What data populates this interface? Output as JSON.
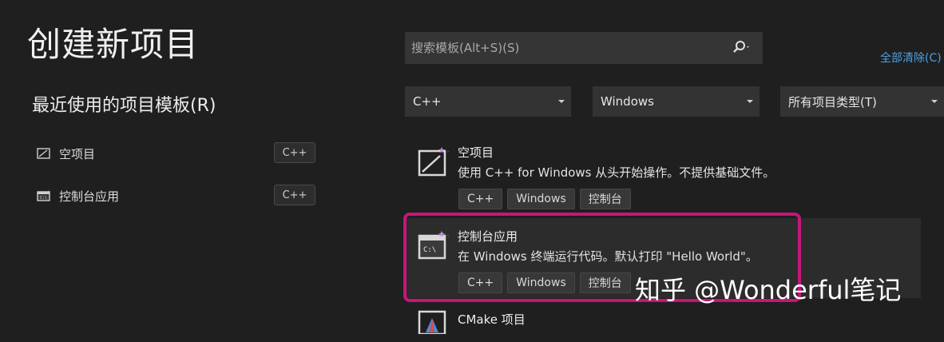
{
  "page": {
    "title": "创建新项目"
  },
  "recent": {
    "title": "最近使用的项目模板(R)",
    "items": [
      {
        "label": "空项目",
        "tag": "C++",
        "icon": "empty-project-icon"
      },
      {
        "label": "控制台应用",
        "tag": "C++",
        "icon": "console-app-icon"
      }
    ]
  },
  "search": {
    "placeholder": "搜索模板(Alt+S)(S)",
    "icon": "search-icon"
  },
  "clear_all": "全部清除(C)",
  "filters": {
    "language": "C++",
    "platform": "Windows",
    "project_type": "所有项目类型(T)"
  },
  "templates": [
    {
      "name": "空项目",
      "description": "使用 C++ for Windows 从头开始操作。不提供基础文件。",
      "tags": [
        "C++",
        "Windows",
        "控制台"
      ]
    },
    {
      "name": "控制台应用",
      "description": "在 Windows 终端运行代码。默认打印 \"Hello World\"。",
      "tags": [
        "C++",
        "Windows",
        "控制台"
      ]
    },
    {
      "name": "CMake 项目"
    }
  ],
  "watermark": "知乎 @Wonderful笔记",
  "colors": {
    "background": "#1f1f1f",
    "link": "#4f9fe3",
    "highlight": "#c7157a"
  }
}
